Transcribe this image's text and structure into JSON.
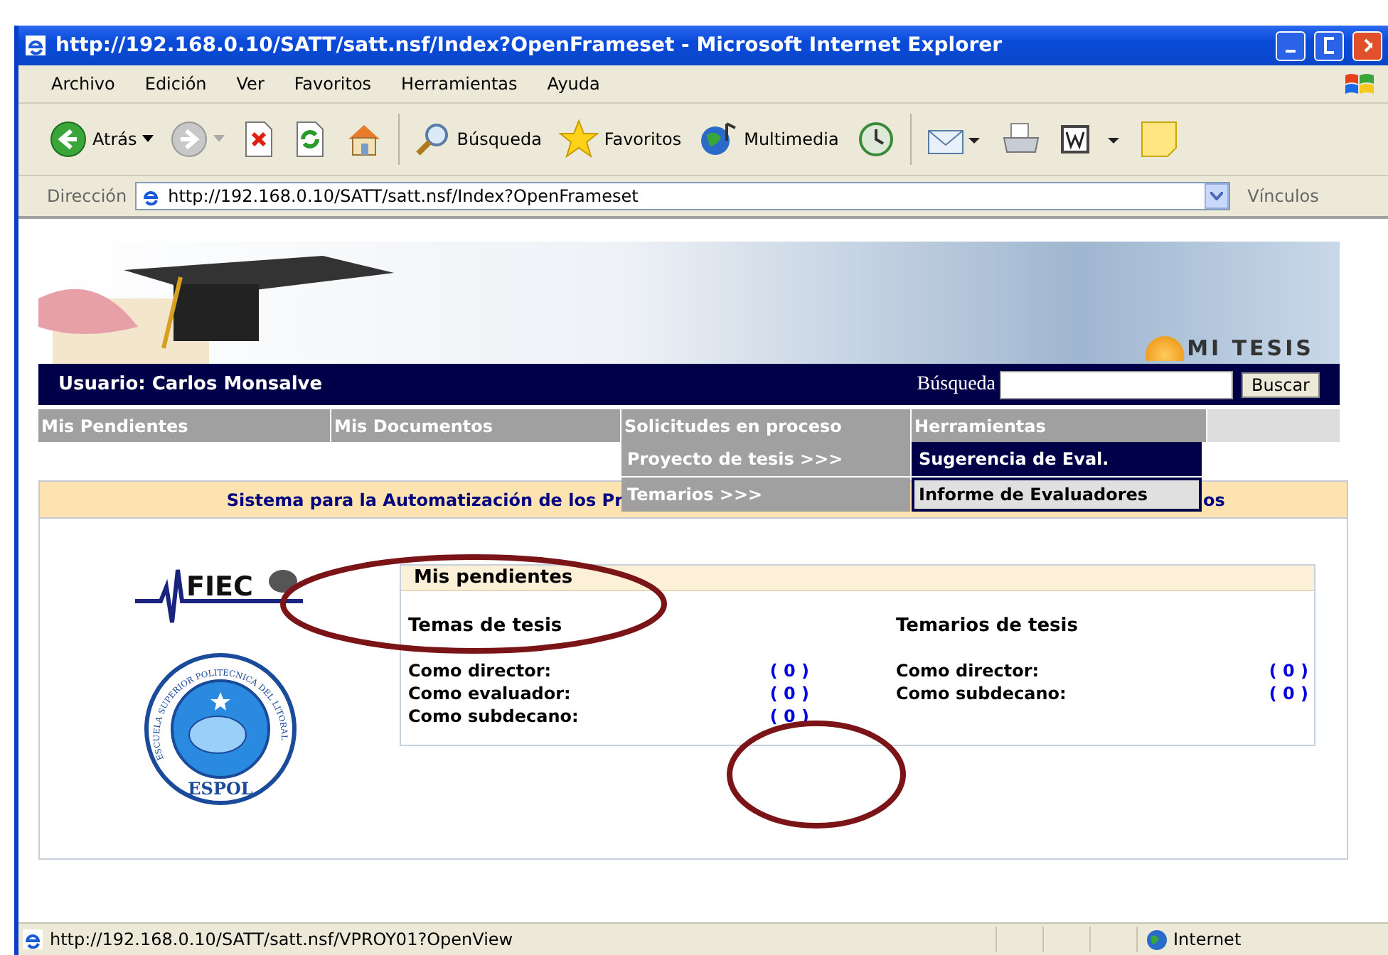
{
  "window": {
    "title": "http://192.168.0.10/SATT/satt.nsf/Index?OpenFrameset - Microsoft Internet Explorer"
  },
  "menu_bar": [
    "Archivo",
    "Edición",
    "Ver",
    "Favoritos",
    "Herramientas",
    "Ayuda"
  ],
  "toolbar": [
    {
      "kind": "back",
      "label": "Atrás"
    },
    {
      "kind": "forward"
    },
    {
      "kind": "stop"
    },
    {
      "kind": "refresh"
    },
    {
      "kind": "home"
    },
    {
      "kind": "search",
      "label": "Búsqueda"
    },
    {
      "kind": "favorites",
      "label": "Favoritos"
    },
    {
      "kind": "media",
      "label": "Multimedia"
    },
    {
      "kind": "history"
    },
    {
      "kind": "mail"
    },
    {
      "kind": "print"
    },
    {
      "kind": "word"
    },
    {
      "kind": "note"
    }
  ],
  "address_bar": {
    "label": "Dirección",
    "value": "http://192.168.0.10/SATT/satt.nsf/Index?OpenFrameset",
    "links": "Vínculos"
  },
  "page": {
    "header_logo": "MI TESIS",
    "user": "Usuario: Carlos Monsalve",
    "search_label": "Búsqueda",
    "search_button": "Buscar",
    "nav": [
      "Mis Pendientes",
      "Mis Documentos",
      "Solicitudes en proceso",
      "Herramientas"
    ],
    "dropdown": [
      "Proyecto de tesis >>>",
      "Temarios >>>"
    ],
    "submenu": [
      {
        "label": "Sugerencia de Eval.",
        "selected": true
      },
      {
        "label": "Informe de Evaluadores",
        "selected": false
      }
    ],
    "banner": {
      "text_start": "Sistema para la Automatización de los Pr",
      "text_end": "os"
    },
    "fiec_logo": "FIEC",
    "seal": {
      "ring_text": "ESCUELA SUPERIOR POLITECNICA DEL LITORAL",
      "name": "ESPOL"
    },
    "panel": {
      "title": "Mis pendientes",
      "columns": [
        {
          "heading": "Temas de tesis",
          "rows": [
            {
              "label": "Como director:",
              "count": "( 0 )"
            },
            {
              "label": "Como evaluador:",
              "count": "( 0 )"
            },
            {
              "label": "Como subdecano:",
              "count": "( 0 )"
            }
          ]
        },
        {
          "heading": "Temarios de tesis",
          "rows": [
            {
              "label": "Como director:",
              "count": "( 0 )"
            },
            {
              "label": "Como subdecano:",
              "count": "( 0 )"
            }
          ]
        }
      ]
    }
  },
  "annotations": [
    {
      "kind": "ellipse"
    },
    {
      "kind": "ellipse"
    }
  ],
  "status_bar": {
    "url": "http://192.168.0.10/SATT/satt.nsf/VPROY01?OpenView",
    "zone": "Internet"
  }
}
